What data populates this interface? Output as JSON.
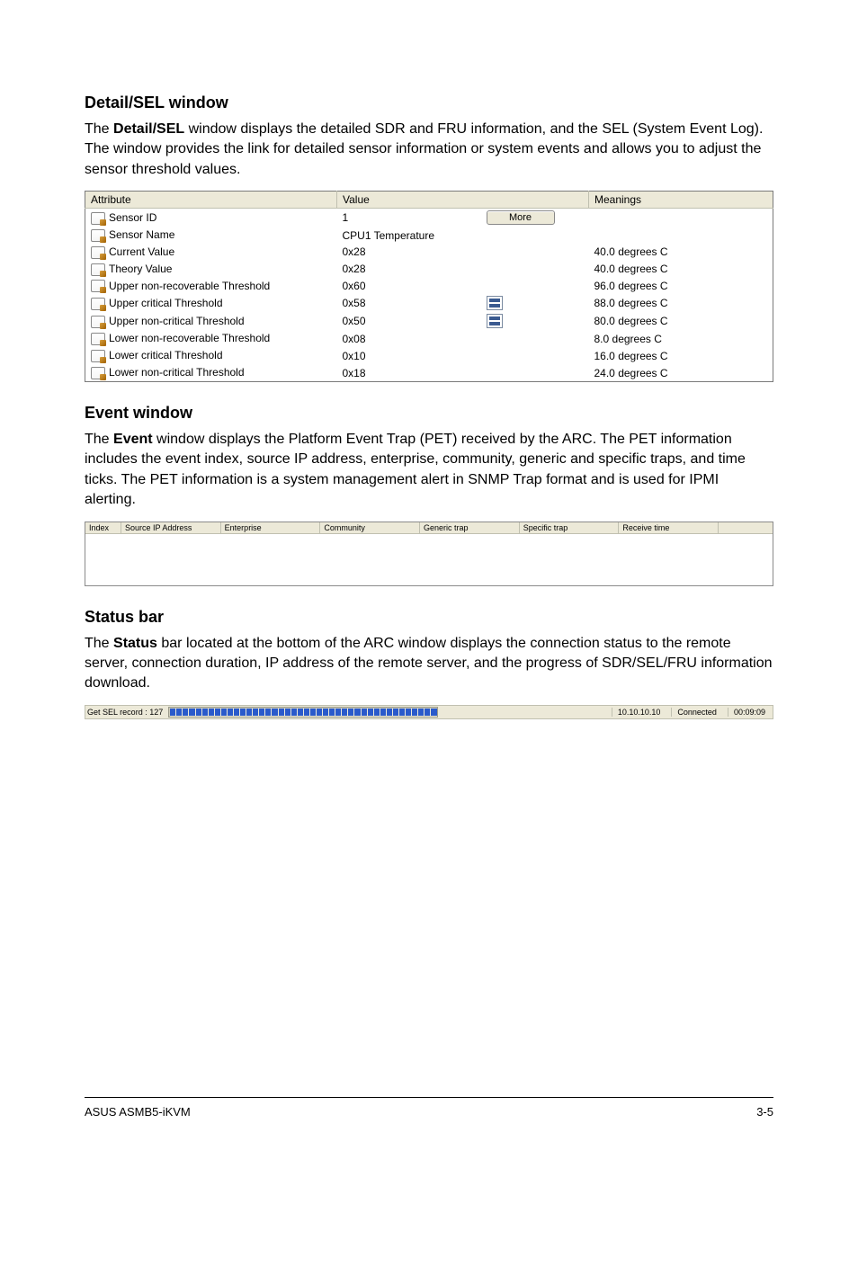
{
  "sections": {
    "detail": {
      "heading": "Detail/SEL window",
      "desc_before": "The ",
      "desc_bold": "Detail/SEL",
      "desc_after": " window displays the detailed SDR and FRU information, and the SEL (System Event Log). The window provides the link for detailed sensor information or system events and allows you to adjust the sensor threshold values."
    },
    "event": {
      "heading": "Event window",
      "desc_before": "The ",
      "desc_bold": "Event",
      "desc_after": " window displays the Platform Event Trap (PET) received by the ARC. The PET information includes the event index, source IP address, enterprise, community, generic and specific traps, and time ticks. The PET information is a system management alert in SNMP Trap format and is used for IPMI alerting."
    },
    "statusbar": {
      "heading": "Status bar",
      "desc_before": "The ",
      "desc_bold": "Status",
      "desc_after": " bar located at the bottom of the ARC window displays the connection status to the remote server, connection duration, IP address of the remote server, and the progress of SDR/SEL/FRU information download."
    }
  },
  "sel_table": {
    "headers": {
      "attr": "Attribute",
      "val": "Value",
      "mean": "Meanings"
    },
    "more_label": "More",
    "rows": [
      {
        "attr": "Sensor ID",
        "val": "1",
        "ctl": "more",
        "mean": ""
      },
      {
        "attr": "Sensor Name",
        "val": "CPU1 Temperature",
        "ctl": "",
        "mean": ""
      },
      {
        "attr": "Current Value",
        "val": "0x28",
        "ctl": "",
        "mean": "40.0 degrees C"
      },
      {
        "attr": "Theory Value",
        "val": "0x28",
        "ctl": "",
        "mean": "40.0 degrees C"
      },
      {
        "attr": "Upper non-recoverable Threshold",
        "val": "0x60",
        "ctl": "",
        "mean": "96.0 degrees C"
      },
      {
        "attr": "Upper critical Threshold",
        "val": "0x58",
        "ctl": "spin",
        "mean": "88.0 degrees C"
      },
      {
        "attr": "Upper non-critical Threshold",
        "val": "0x50",
        "ctl": "spin",
        "mean": "80.0 degrees C"
      },
      {
        "attr": "Lower non-recoverable Threshold",
        "val": "0x08",
        "ctl": "",
        "mean": "8.0 degrees C"
      },
      {
        "attr": "Lower critical Threshold",
        "val": "0x10",
        "ctl": "",
        "mean": "16.0 degrees C"
      },
      {
        "attr": "Lower non-critical Threshold",
        "val": "0x18",
        "ctl": "",
        "mean": "24.0 degrees C"
      }
    ]
  },
  "event_table": {
    "headers": [
      "Index",
      "Source IP Address",
      "Enterprise",
      "Community",
      "Generic trap",
      "Specific trap",
      "Receive time",
      ""
    ]
  },
  "status": {
    "record_label": "Get SEL record : 127",
    "ip": "10.10.10.10",
    "conn": "Connected",
    "duration": "00:09:09"
  },
  "footer": {
    "left": "ASUS ASMB5-iKVM",
    "right": "3-5"
  }
}
